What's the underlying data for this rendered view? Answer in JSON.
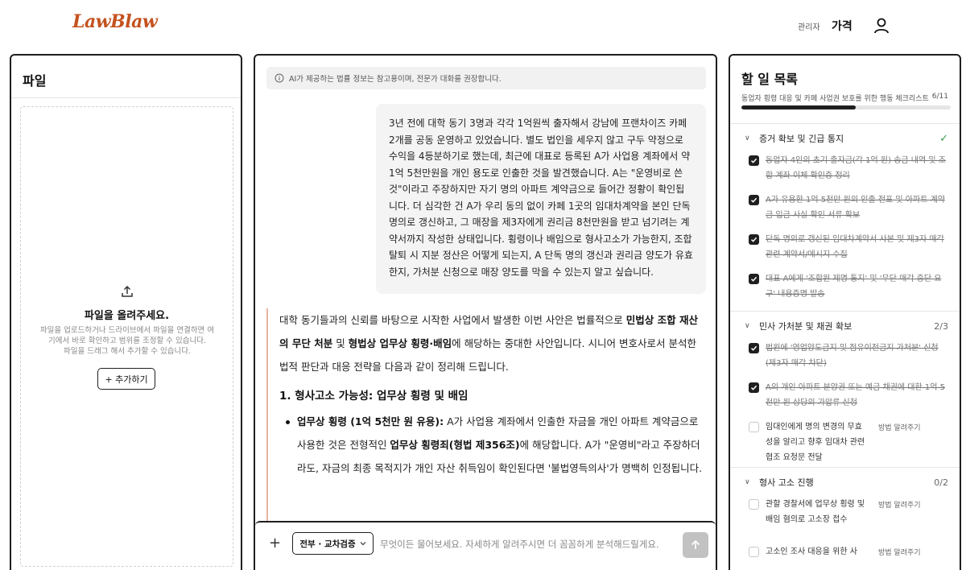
{
  "header": {
    "logo": "LawBlaw",
    "admin": "관리자",
    "price": "가격"
  },
  "files": {
    "title": "파일",
    "drop_title": "파일을 올려주세요.",
    "drop_desc_1": "파일을 업로드하거나 드라이브에서 파일을 연결하면 여",
    "drop_desc_2": "기에서 바로 확인하고 범위를 조정할 수 있습니다.",
    "drop_desc_3": "파일을 드래그 해서 추가할 수 있습니다.",
    "add_button": "+ 추가하기"
  },
  "chat": {
    "notice": "AI가 제공하는 법률 정보는 참고용이며, 전문가 대화를 권장합니다.",
    "user_message": "3년 전에 대학 동기 3명과 각각 1억원씩 출자해서 강남에 프랜차이즈 카페 2개를 공동 운영하고 있었습니다. 별도 법인을 세우지 않고 구두 약정으로 수익을 4등분하기로 했는데, 최근에 대표로 등록된 A가 사업용 계좌에서 약 1억 5천만원을 개인 용도로 인출한 것을 발견했습니다. A는 \"운영비로 쓴 것\"이라고 주장하지만 자기 명의 아파트 계약금으로 들어간 정황이 확인됩니다. 더 심각한 건 A가 우리 동의 없이 카페 1곳의 임대차계약을 본인 단독 명의로 갱신하고, 그 매장을 제3자에게 권리금 8천만원을 받고 넘기려는 계약서까지 작성한 상태입니다. 횡령이나 배임으로 형사고소가 가능한지, 조합 탈퇴 시 지분 정산은 어떻게 되는지, A 단독 명의 갱신과 권리금 양도가 유효한지, 가처분 신청으로 매장 양도를 막을 수 있는지 알고 싶습니다.",
    "ai": {
      "p1_a": "대학 동기들과의 신뢰를 바탕으로 시작한 사업에서 발생한 이번 사안은 법률적으로 ",
      "p1_b1": "민법상 조합 재산의 무단 처분",
      "p1_c": " 및 ",
      "p1_b2": "형법상 업무상 횡령·배임",
      "p1_d": "에 해당하는 중대한 사안입니다. 시니어 변호사로서 분석한 법적 판단과 대응 전략을 다음과 같이 정리해 드립니다.",
      "heading": "1. 형사고소 가능성: 업무상 횡령 및 배임",
      "li1_b": "업무상 횡령 (1억 5천만 원 유용):",
      "li1_a": " A가 사업용 계좌에서 인출한 자금을 개인 아파트 계약금으로 사용한 것은 전형적인 ",
      "li1_b2": "업무상 횡령죄(형법 제356조)",
      "li1_c": "에 해당합니다. A가 \"운영비\"라고 주장하더라도, 자금의 최종 목적지가 개인 자산 취득임이 확인된다면 '불법영득의사'가 명백히 인정됩니다."
    },
    "mode_label": "전부 · 교차검증",
    "input_placeholder": "무엇이든 물어보세요. 자세하게 알려주시면 더 꼼꼼하게 분석해드릴게요."
  },
  "todo": {
    "title": "할 일 목록",
    "subtitle": "동업자 횡령 대응 및 카페 사업권 보호를 위한 행동 체크리스트",
    "count": "6/11",
    "progress": 0.545,
    "how_label": "방법 알려주기",
    "sections": [
      {
        "title": "증거 확보 및 긴급 통지",
        "count": "",
        "complete": true,
        "items": [
          {
            "text": "동업자 4인의 초기 출자금(각 1억 원) 송금 내역 및 조합 계좌 이체 확인증 정리",
            "done": true
          },
          {
            "text": "A가 유용한 1억 5천만 원의 인출 전표 및 아파트 계약금 입금 사실 확인 서류 확보",
            "done": true
          },
          {
            "text": "단독 명의로 갱신된 임대차계약서 사본 및 제3자 매각 관련 계약서/메시지 수집",
            "done": true
          },
          {
            "text": "대표 A에게 '조합원 제명 통지' 및 '무단 매각 중단 요구' 내용증명 발송",
            "done": true
          }
        ]
      },
      {
        "title": "민사 가처분 및 채권 확보",
        "count": "2/3",
        "complete": false,
        "items": [
          {
            "text": "법원에 '영업양도금지 및 점유이전금지 가처분' 신청 (제3자 매각 차단)",
            "done": true
          },
          {
            "text": "A의 개인 아파트 분양권 또는 예금 채권에 대한 1억 5천만 원 상당의 가압류 신청",
            "done": true
          },
          {
            "text": "임대인에게 명의 변경의 무효성을 알리고 향후 임대차 관련 협조 요청문 전달",
            "done": false
          }
        ]
      },
      {
        "title": "형사 고소 진행",
        "count": "0/2",
        "complete": false,
        "items": [
          {
            "text": "관할 경찰서에 업무상 횡령 및 배임 혐의로 고소장 접수",
            "done": false
          },
          {
            "text": "고소인 조사 대응을 위한 사",
            "done": false
          }
        ]
      }
    ]
  }
}
